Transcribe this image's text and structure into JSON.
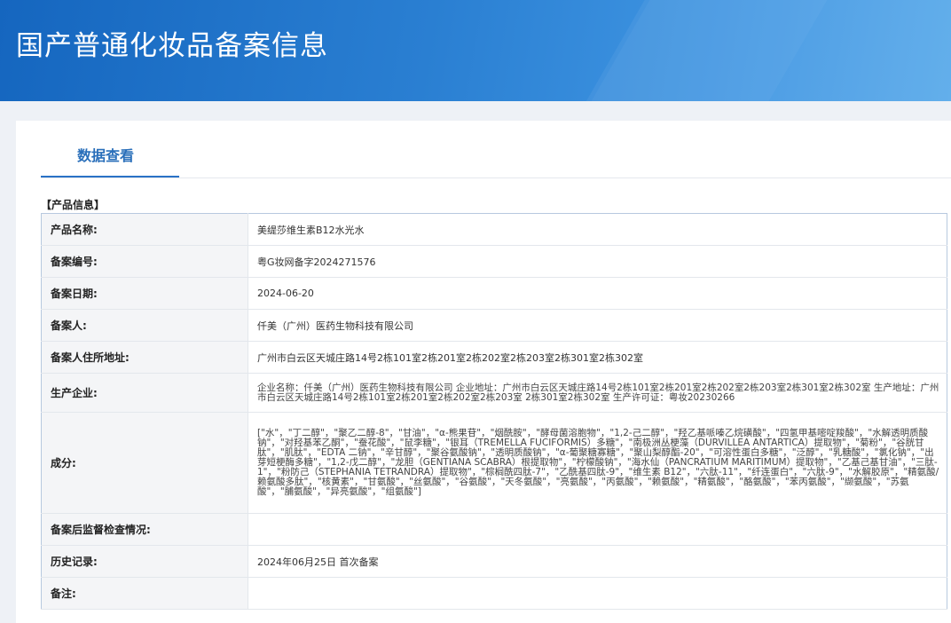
{
  "header": {
    "title": "国产普通化妆品备案信息"
  },
  "tabs": [
    {
      "label": "数据查看"
    }
  ],
  "section": {
    "title": "【产品信息】"
  },
  "rows": [
    {
      "label": "产品名称:",
      "value": "美缇莎维生素B12水光水"
    },
    {
      "label": "备案编号:",
      "value": "粤G妆网备字2024271576"
    },
    {
      "label": "备案日期:",
      "value": "2024-06-20"
    },
    {
      "label": "备案人:",
      "value": "仟美（广州）医药生物科技有限公司"
    },
    {
      "label": "备案人住所地址:",
      "value": "广州市白云区天城庄路14号2栋101室2栋201室2栋202室2栋203室2栋301室2栋302室"
    },
    {
      "label": "生产企业:",
      "value": "企业名称：仟美（广州）医药生物科技有限公司 企业地址：广州市白云区天城庄路14号2栋101室2栋201室2栋202室2栋203室2栋301室2栋302室 生产地址：广州市白云区天城庄路14号2栋101室2栋201室2栋202室2栋203室 2栋301室2栋302室 生产许可证：粤妆20230266"
    },
    {
      "label": "成分:",
      "value": "[\"水\"，\"丁二醇\"，\"聚乙二醇-8\"，\"甘油\"，\"α-熊果苷\"，\"烟酰胺\"，\"酵母菌溶胞物\"，\"1,2-己二醇\"，\"羟乙基哌嗪乙烷磺酸\"，\"四氢甲基嘧啶羧酸\"，\"水解透明质酸钠\"，\"对羟基苯乙酮\"，\"蚕花酸\"，\"鼠李糖\"，\"银耳（TREMELLA FUCIFORMIS）多糖\"，\"南极洲丛梗藻（DURVILLEA ANTARTICA）提取物\"，\"菊粉\"，\"谷胱甘肽\"，\"肌肽\"，\"EDTA 二钠\"，\"辛甘醇\"，\"聚谷氨酸钠\"，\"透明质酸钠\"，\"α-葡聚糖寡糖\"，\"聚山梨醇酯-20\"，\"可溶性蛋白多糖\"，\"泛醇\"，\"乳糖酸\"，\"氯化钠\"，\"出芽短梗酶多糖\"，\"1,2-戊二醇\"，\"龙胆（GENTIANA SCABRA）根提取物\"，\"柠檬酸钠\"，\"海水仙（PANCRATIUM MARITIMUM）提取物\"，\"乙基己基甘油\"，\"三肽-1\"，\"粉防己（STEPHANIA TETRANDRA）提取物\"，\"棕榈酰四肽-7\"，\"乙酰基四肽-9\"，\"维生素 B12\"，\"六肽-11\"，\"纤连蛋白\"，\"六肽-9\"，\"水解胶原\"，\"精氨酸/赖氨酸多肽\"，\"核黄素\"，\"甘氨酸\"，\"丝氨酸\"，\"谷氨酸\"，\"天冬氨酸\"，\"亮氨酸\"，\"丙氨酸\"，\"赖氨酸\"，\"精氨酸\"，\"酪氨酸\"，\"苯丙氨酸\"，\"缬氨酸\"，\"苏氨酸\"，\"脯氨酸\"，\"异亮氨酸\"，\"组氨酸\"]"
    },
    {
      "label": "备案后监督检查情况:",
      "value": ""
    },
    {
      "label": "历史记录:",
      "value": "2024年06月25日 首次备案"
    },
    {
      "label": "备注:",
      "value": ""
    }
  ]
}
